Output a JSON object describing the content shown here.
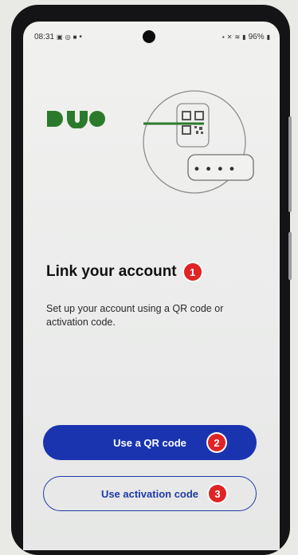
{
  "status_bar": {
    "time": "08:31",
    "notification_icons": [
      "photos-icon",
      "voicemail-icon",
      "app-icon"
    ],
    "dot": "•",
    "system_icons": [
      "nfc-icon",
      "mute-icon",
      "wifi-icon",
      "signal-icon"
    ],
    "battery_text": "96%"
  },
  "brand": {
    "logo_text": "DUO",
    "color": "#2b7a2b"
  },
  "illustration": {
    "code_dots": "• • • •"
  },
  "main": {
    "title": "Link your account",
    "description": "Set up your account using a QR code or activation code."
  },
  "buttons": {
    "qr": "Use a QR code",
    "activation": "Use activation code"
  },
  "markers": {
    "title": "1",
    "qr": "2",
    "activation": "3"
  },
  "colors": {
    "primary_button": "#1a34b0",
    "outline_button": "#1f3aa8",
    "marker": "#e02424",
    "scan_line": "#2b7a2b"
  }
}
